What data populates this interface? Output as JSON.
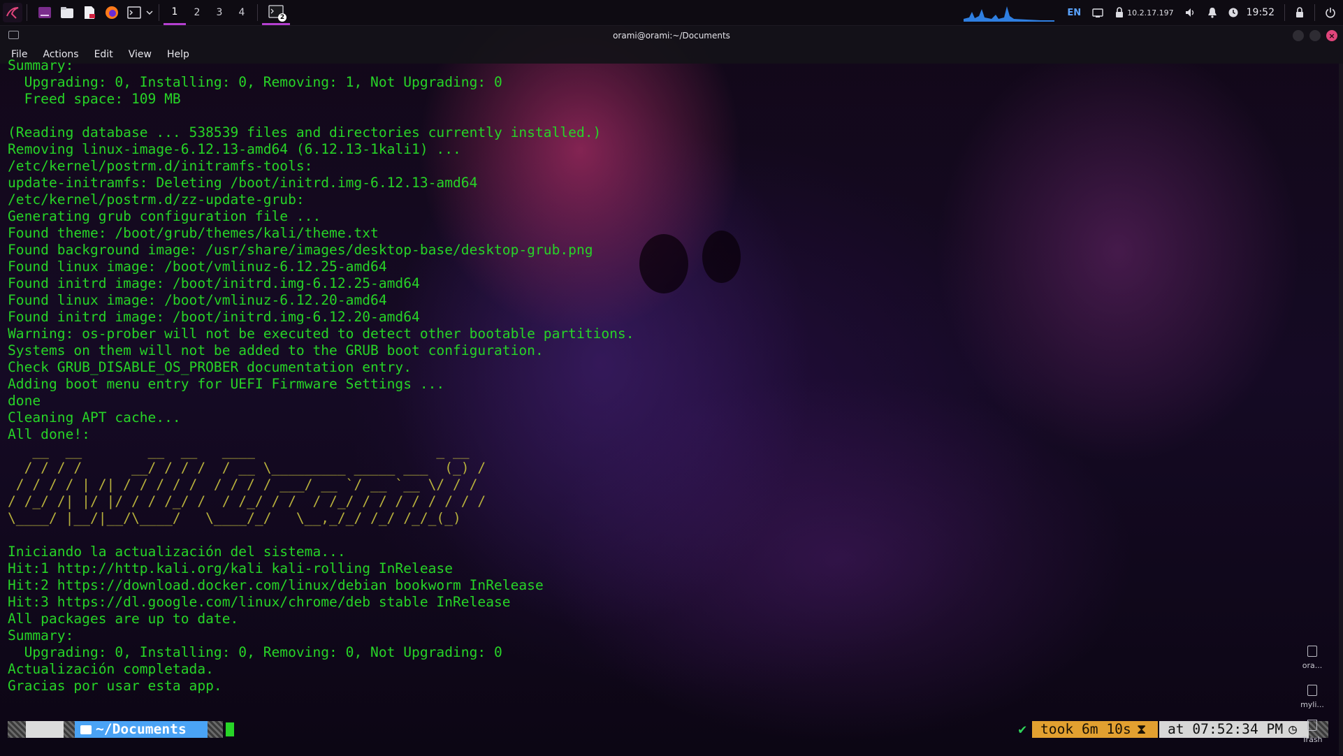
{
  "panel": {
    "workspaces": [
      "1",
      "2",
      "3",
      "4"
    ],
    "active_workspace": "1",
    "task_badge": "2",
    "language": "EN",
    "ip": "10.2.17.197",
    "clock": "19:52",
    "icons": [
      "kali-logo-icon",
      "workspace-app-icon",
      "file-manager-icon",
      "text-editor-icon",
      "firefox-icon",
      "terminal-icon",
      "chevron-down-icon",
      "network-icon",
      "vpn-lock-icon",
      "volume-icon",
      "notification-bell-icon",
      "power-icon",
      "lock-icon"
    ]
  },
  "window": {
    "title": "orami@orami:~/Documents",
    "menu": [
      "File",
      "Actions",
      "Edit",
      "View",
      "Help"
    ]
  },
  "terminal": {
    "lines": [
      "Summary:",
      "  Upgrading: 0, Installing: 0, Removing: 1, Not Upgrading: 0",
      "  Freed space: 109 MB",
      "",
      "(Reading database ... 538539 files and directories currently installed.)",
      "Removing linux-image-6.12.13-amd64 (6.12.13-1kali1) ...",
      "/etc/kernel/postrm.d/initramfs-tools:",
      "update-initramfs: Deleting /boot/initrd.img-6.12.13-amd64",
      "/etc/kernel/postrm.d/zz-update-grub:",
      "Generating grub configuration file ...",
      "Found theme: /boot/grub/themes/kali/theme.txt",
      "Found background image: /usr/share/images/desktop-base/desktop-grub.png",
      "Found linux image: /boot/vmlinuz-6.12.25-amd64",
      "Found initrd image: /boot/initrd.img-6.12.25-amd64",
      "Found linux image: /boot/vmlinuz-6.12.20-amd64",
      "Found initrd image: /boot/initrd.img-6.12.20-amd64",
      "Warning: os-prober will not be executed to detect other bootable partitions.",
      "Systems on them will not be added to the GRUB boot configuration.",
      "Check GRUB_DISABLE_OS_PROBER documentation entry.",
      "Adding boot menu entry for UEFI Firmware Settings ...",
      "done",
      "Cleaning APT cache...",
      "All done!:"
    ],
    "ascii_art": [
      "   __  __        __  __   ____                      _ __",
      "  / / / /      __/ / / /  / __ \\_________ _____ ___  (_) /",
      " / / / / | /| / / / / /  / / / / ___/ __ `/ __ `__ \\/ / /",
      "/ /_/ /| |/ |/ / / /_/ /  / /_/ / /  / /_/ / / / / / / / /",
      "\\____/ |__/|__/\\____/   \\____/_/   \\__,_/_/ /_/ /_/_(_)"
    ],
    "lines_after": [
      "",
      "Iniciando la actualización del sistema...",
      "Hit:1 http://http.kali.org/kali kali-rolling InRelease",
      "Hit:2 https://download.docker.com/linux/debian bookworm InRelease",
      "Hit:3 https://dl.google.com/linux/chrome/deb stable InRelease",
      "All packages are up to date.",
      "Summary:",
      "  Upgrading: 0, Installing: 0, Removing: 0, Not Upgrading: 0",
      "Actualización completada.",
      "Gracias por usar esta app."
    ]
  },
  "prompt": {
    "os_glyph": "",
    "directory": "~/Documents",
    "status_check": "✔",
    "took": "took 6m 10s",
    "at": "at 07:52:34 PM"
  },
  "desktop": {
    "icons": [
      {
        "label": "ora...",
        "icon": "file-icon"
      },
      {
        "label": "myli...",
        "icon": "file-icon"
      },
      {
        "label": "Trash",
        "icon": "trash-icon"
      }
    ]
  },
  "colors": {
    "terminal_text": "#27d427",
    "ascii_art": "#b8b13c",
    "accent": "#b43fd0",
    "prompt_dir": "#4aa3f5",
    "prompt_took": "#e2a030"
  }
}
